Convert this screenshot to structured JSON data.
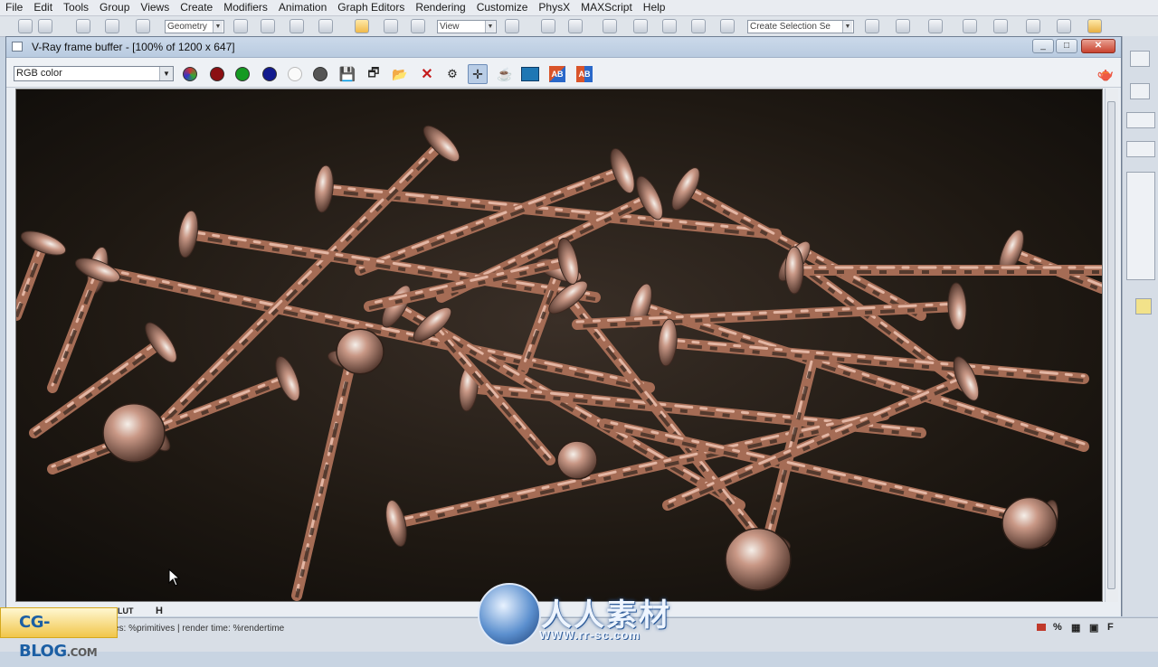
{
  "menu": [
    "File",
    "Edit",
    "Tools",
    "Group",
    "Views",
    "Create",
    "Modifiers",
    "Animation",
    "Graph Editors",
    "Rendering",
    "Customize",
    "PhysX",
    "MAXScript",
    "Help"
  ],
  "main_toolbar": {
    "selection_filter": "Geometry",
    "reference_coord": "View",
    "named_selection_placeholder": "Create Selection Se"
  },
  "vfb": {
    "title": "V-Ray frame buffer - [100% of 1200 x 647]",
    "channel": "RGB color",
    "min_label": "_",
    "max_label": "□",
    "close_label": "✕"
  },
  "status": {
    "text": "es: %primitives | render time: %rendertime",
    "lut_label": "LUT",
    "h_label": "H"
  },
  "watermarks": {
    "cgblog": "CG-BLOG",
    "cgblog_suffix": ".COM",
    "rr_cn": "人人素材",
    "rr_url": "WWW.rr-sc.com"
  },
  "colors": {
    "render_bg": "#1e1812",
    "copper": "#b77a62",
    "rust": "#3a2a22"
  }
}
